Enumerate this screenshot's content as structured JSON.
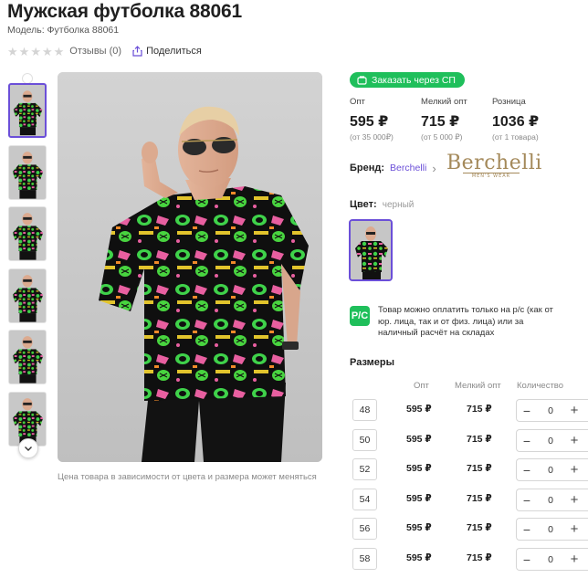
{
  "product": {
    "title": "Мужская футболка 88061",
    "model": "Модель: Футболка 88061",
    "rating_stars": 0,
    "reviews": "Отзывы (0)",
    "share": "Поделиться"
  },
  "gallery": {
    "thumb_count": 6,
    "active_thumb": 0,
    "price_note": "Цена товара в зависимости от цвета и размера может меняться"
  },
  "sp_button": "Заказать через СП",
  "prices": [
    {
      "label": "Опт",
      "value": "595 ₽",
      "note": "(от 35 000₽)"
    },
    {
      "label": "Мелкий опт",
      "value": "715 ₽",
      "note": "(от 5 000 ₽)"
    },
    {
      "label": "Розница",
      "value": "1036 ₽",
      "note": "(от 1 товара)"
    }
  ],
  "brand": {
    "label": "Бренд:",
    "name": "Berchelli",
    "logo_word": "Berchelli",
    "logo_sub": "MEN'S WEAR"
  },
  "color": {
    "label": "Цвет:",
    "value": "черный"
  },
  "payment_note": "Товар можно оплатить только на р/с (как от юр. лица, так и от физ. лица) или за наличный расчёт на складах",
  "payment_icon": "Р/С",
  "sizes": {
    "title": "Размеры",
    "headers": {
      "opt": "Опт",
      "small_opt": "Мелкий опт",
      "qty": "Количество"
    },
    "rows": [
      {
        "size": "48",
        "opt": "595 ₽",
        "small_opt": "715 ₽",
        "qty": "0"
      },
      {
        "size": "50",
        "opt": "595 ₽",
        "small_opt": "715 ₽",
        "qty": "0"
      },
      {
        "size": "52",
        "opt": "595 ₽",
        "small_opt": "715 ₽",
        "qty": "0"
      },
      {
        "size": "54",
        "opt": "595 ₽",
        "small_opt": "715 ₽",
        "qty": "0"
      },
      {
        "size": "56",
        "opt": "595 ₽",
        "small_opt": "715 ₽",
        "qty": "0"
      },
      {
        "size": "58",
        "opt": "595 ₽",
        "small_opt": "715 ₽",
        "qty": "0"
      }
    ]
  },
  "colors": {
    "accent": "#6b4fd8",
    "green": "#1fbf5b",
    "brand_gold": "#a4895a"
  }
}
